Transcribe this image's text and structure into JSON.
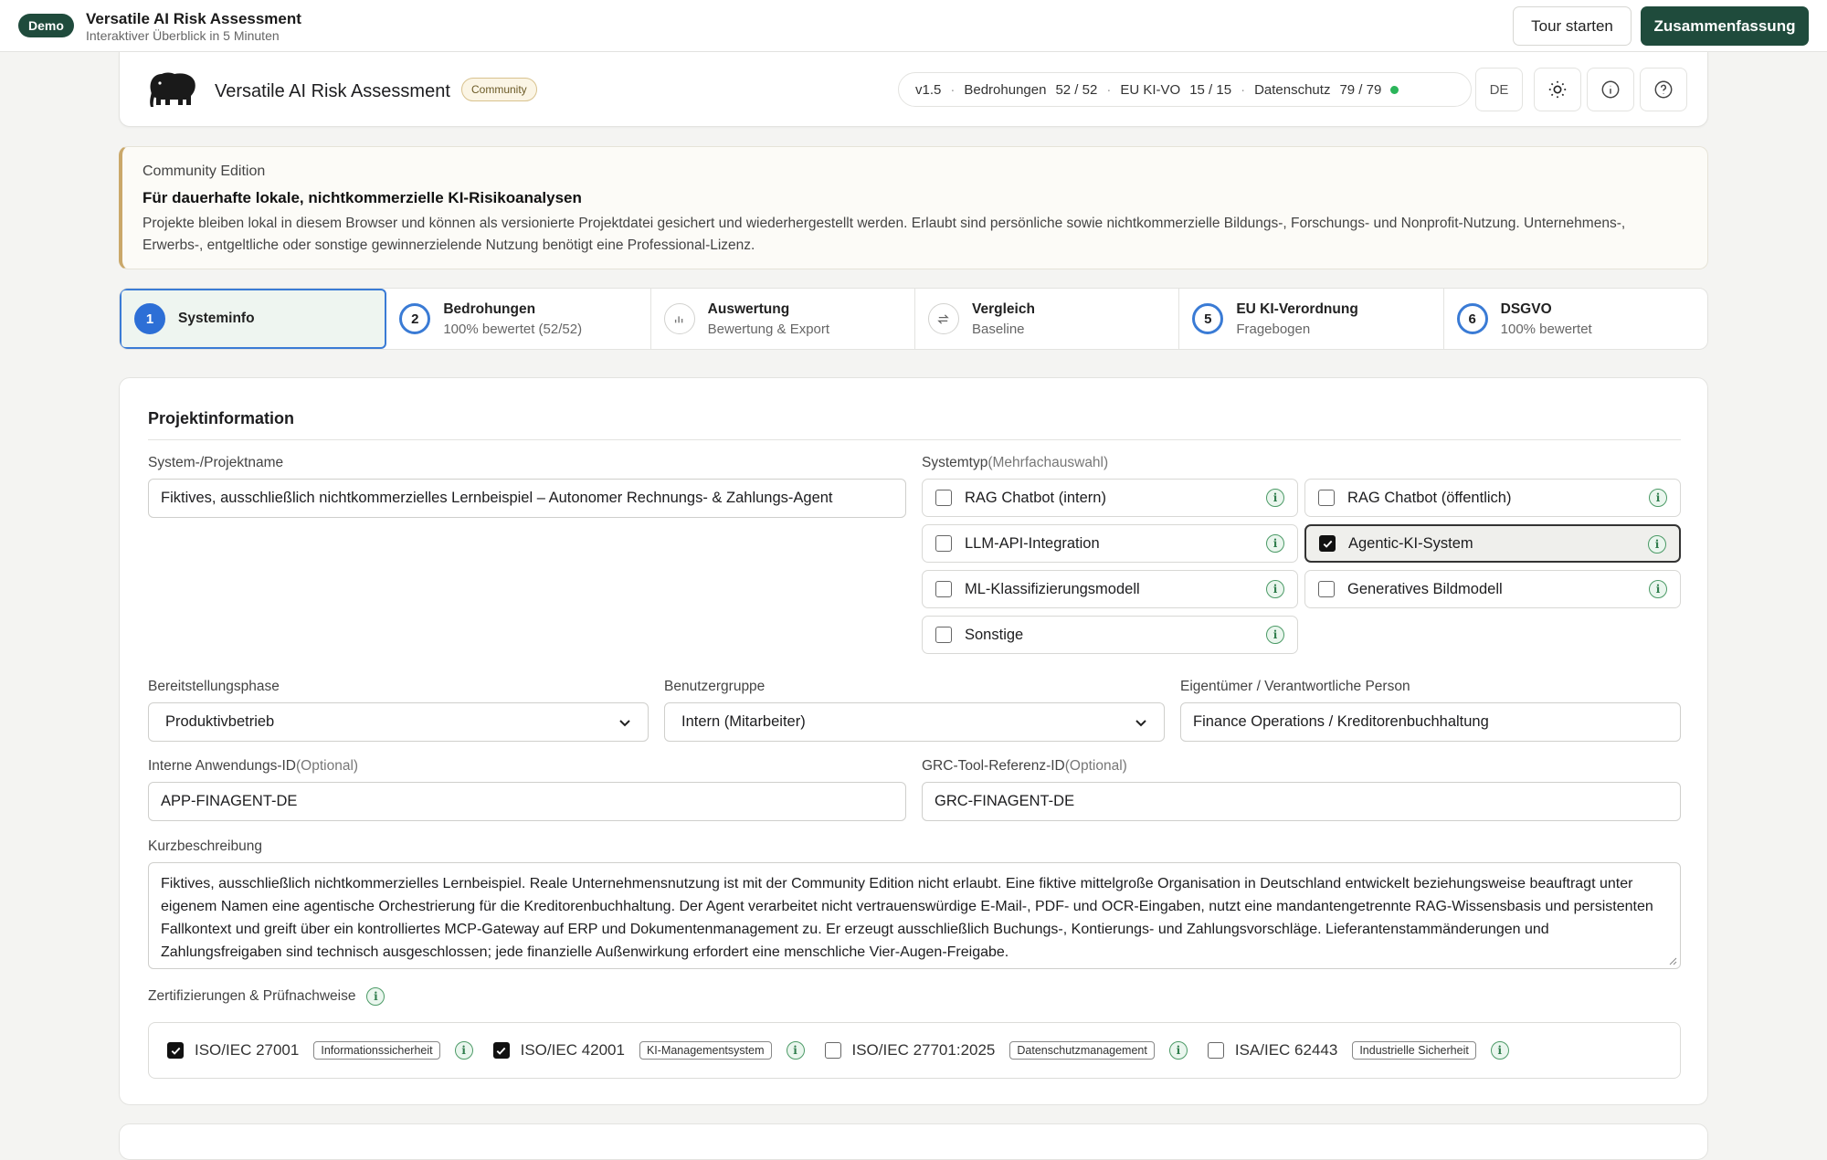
{
  "topbar": {
    "demo_badge": "Demo",
    "title": "Versatile AI Risk Assessment",
    "subtitle": "Interaktiver Überblick in 5 Minuten",
    "tour_label": "Tour starten",
    "summary_label": "Zusammenfassung"
  },
  "header": {
    "app_name": "Versatile AI Risk Assessment",
    "edition_badge": "Community",
    "stats": {
      "version": "v1.5",
      "threats_label": "Bedrohungen",
      "threats_value": "52 / 52",
      "euai_label": "EU KI-VO",
      "euai_value": "15 / 15",
      "privacy_label": "Datenschutz",
      "privacy_value": "79 / 79"
    },
    "language": "DE",
    "status_color": "#2bb55a"
  },
  "notice": {
    "edition": "Community Edition",
    "title": "Für dauerhafte lokale, nichtkommerzielle KI-Risikoanalysen",
    "text": "Projekte bleiben lokal in diesem Browser und können als versionierte Projektdatei gesichert und wiederhergestellt werden. Erlaubt sind persönliche sowie nichtkommerzielle Bildungs-, Forschungs- und Nonprofit-Nutzung. Unternehmens-, Erwerbs-, entgeltliche oder sonstige gewinnerzielende Nutzung benötigt eine Professional-Lizenz."
  },
  "steps": [
    {
      "num": "1",
      "label": "Systeminfo",
      "sub": ""
    },
    {
      "num": "2",
      "label": "Bedrohungen",
      "sub": "100% bewertet (52/52)"
    },
    {
      "num": "",
      "label": "Auswertung",
      "sub": "Bewertung & Export"
    },
    {
      "num": "",
      "label": "Vergleich",
      "sub": "Baseline"
    },
    {
      "num": "5",
      "label": "EU KI-Verordnung",
      "sub": "Fragebogen"
    },
    {
      "num": "6",
      "label": "DSGVO",
      "sub": "100% bewertet"
    }
  ],
  "project": {
    "section_title": "Projektinformation",
    "name_label": "System-/Projektname",
    "name_value": "Fiktives, ausschließlich nichtkommerzielles Lernbeispiel – Autonomer Rechnungs- & Zahlungs-Agent",
    "systype_label": "Systemtyp",
    "systype_hint": "(Mehrfachauswahl)",
    "systypes": [
      {
        "label": "RAG Chatbot (intern)",
        "checked": false
      },
      {
        "label": "RAG Chatbot (öffentlich)",
        "checked": false
      },
      {
        "label": "LLM-API-Integration",
        "checked": false
      },
      {
        "label": "Agentic-KI-System",
        "checked": true
      },
      {
        "label": "ML-Klassifizierungsmodell",
        "checked": false
      },
      {
        "label": "Generatives Bildmodell",
        "checked": false
      },
      {
        "label": "Sonstige",
        "checked": false
      }
    ],
    "phase_label": "Bereitstellungsphase",
    "phase_value": "Produktivbetrieb",
    "users_label": "Benutzergruppe",
    "users_value": "Intern (Mitarbeiter)",
    "owner_label": "Eigentümer / Verantwortliche Person",
    "owner_value": "Finance Operations / Kreditorenbuchhaltung",
    "appid_label": "Interne Anwendungs-ID",
    "appid_hint": "(Optional)",
    "appid_value": "APP-FINAGENT-DE",
    "grc_label": "GRC-Tool-Referenz-ID",
    "grc_hint": "(Optional)",
    "grc_value": "GRC-FINAGENT-DE",
    "desc_label": "Kurzbeschreibung",
    "desc_value": "Fiktives, ausschließlich nichtkommerzielles Lernbeispiel. Reale Unternehmensnutzung ist mit der Community Edition nicht erlaubt. Eine fiktive mittelgroße Organisation in Deutschland entwickelt beziehungsweise beauftragt unter eigenem Namen eine agentische Orchestrierung für die Kreditorenbuchhaltung. Der Agent verarbeitet nicht vertrauenswürdige E-Mail-, PDF- und OCR-Eingaben, nutzt eine mandantengetrennte RAG-Wissensbasis und persistenten Fallkontext und greift über ein kontrolliertes MCP-Gateway auf ERP und Dokumentenmanagement zu. Er erzeugt ausschließlich Buchungs-, Kontierungs- und Zahlungsvorschläge. Lieferantenstammänderungen und Zahlungsfreigaben sind technisch ausgeschlossen; jede finanzielle Außenwirkung erfordert eine menschliche Vier-Augen-Freigabe.",
    "certs_label": "Zertifizierungen & Prüfnachweise",
    "certs": [
      {
        "name": "ISO/IEC 27001",
        "tag": "Informationssicherheit",
        "checked": true
      },
      {
        "name": "ISO/IEC 42001",
        "tag": "KI-Managementsystem",
        "checked": true
      },
      {
        "name": "ISO/IEC 27701:2025",
        "tag": "Datenschutzmanagement",
        "checked": false
      },
      {
        "name": "ISA/IEC 62443",
        "tag": "Industrielle Sicherheit",
        "checked": false
      }
    ]
  }
}
